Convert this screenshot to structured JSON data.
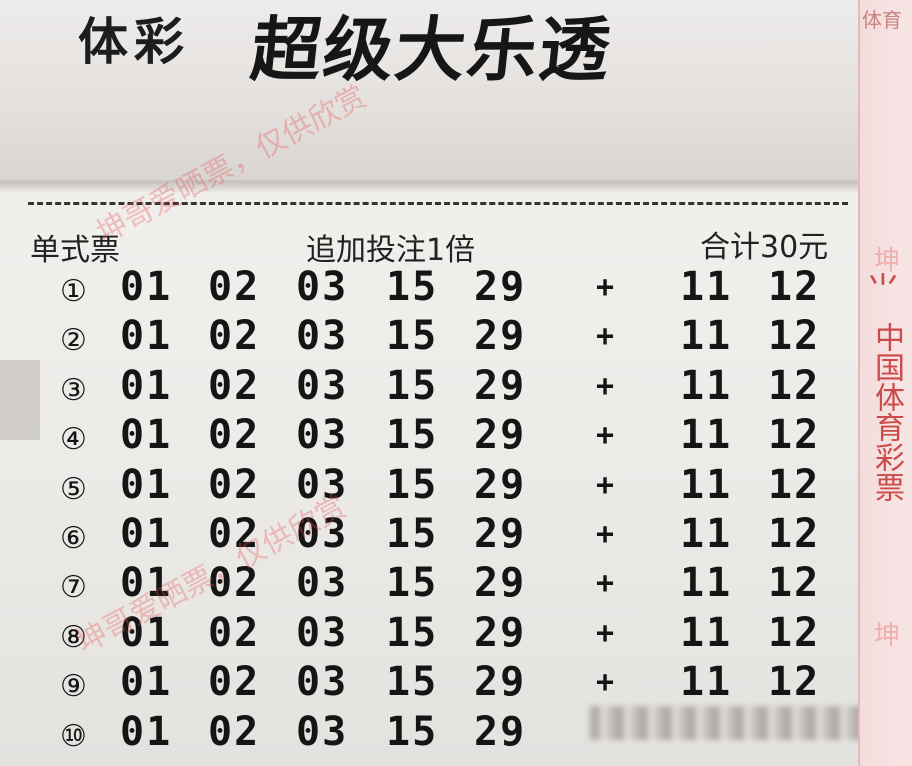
{
  "header": {
    "brand_small": "体彩",
    "brand_big": "超级大乐透"
  },
  "ticket": {
    "type": "单式票",
    "bet_info": "追加投注1倍",
    "total": "合计30元",
    "plus_symbol": "+",
    "rows": [
      {
        "index": "①",
        "front": [
          "01",
          "02",
          "03",
          "15",
          "29"
        ],
        "back": [
          "11",
          "12"
        ]
      },
      {
        "index": "②",
        "front": [
          "01",
          "02",
          "03",
          "15",
          "29"
        ],
        "back": [
          "11",
          "12"
        ]
      },
      {
        "index": "③",
        "front": [
          "01",
          "02",
          "03",
          "15",
          "29"
        ],
        "back": [
          "11",
          "12"
        ]
      },
      {
        "index": "④",
        "front": [
          "01",
          "02",
          "03",
          "15",
          "29"
        ],
        "back": [
          "11",
          "12"
        ]
      },
      {
        "index": "⑤",
        "front": [
          "01",
          "02",
          "03",
          "15",
          "29"
        ],
        "back": [
          "11",
          "12"
        ]
      },
      {
        "index": "⑥",
        "front": [
          "01",
          "02",
          "03",
          "15",
          "29"
        ],
        "back": [
          "11",
          "12"
        ]
      },
      {
        "index": "⑦",
        "front": [
          "01",
          "02",
          "03",
          "15",
          "29"
        ],
        "back": [
          "11",
          "12"
        ]
      },
      {
        "index": "⑧",
        "front": [
          "01",
          "02",
          "03",
          "15",
          "29"
        ],
        "back": [
          "11",
          "12"
        ]
      },
      {
        "index": "⑨",
        "front": [
          "01",
          "02",
          "03",
          "15",
          "29"
        ],
        "back": [
          "11",
          "12"
        ]
      },
      {
        "index": "⑩",
        "front": [
          "01",
          "02",
          "03",
          "15",
          "29"
        ],
        "back": []
      }
    ]
  },
  "side": {
    "top_text": "体育",
    "vertical_text": "中国体育彩票",
    "watermark_char": "坤"
  },
  "watermark": {
    "text": "坤哥爱晒票，仅供欣赏"
  },
  "colors": {
    "ink": "#151515",
    "watermark": "#e85050",
    "side_band": "#f3dcdc"
  }
}
